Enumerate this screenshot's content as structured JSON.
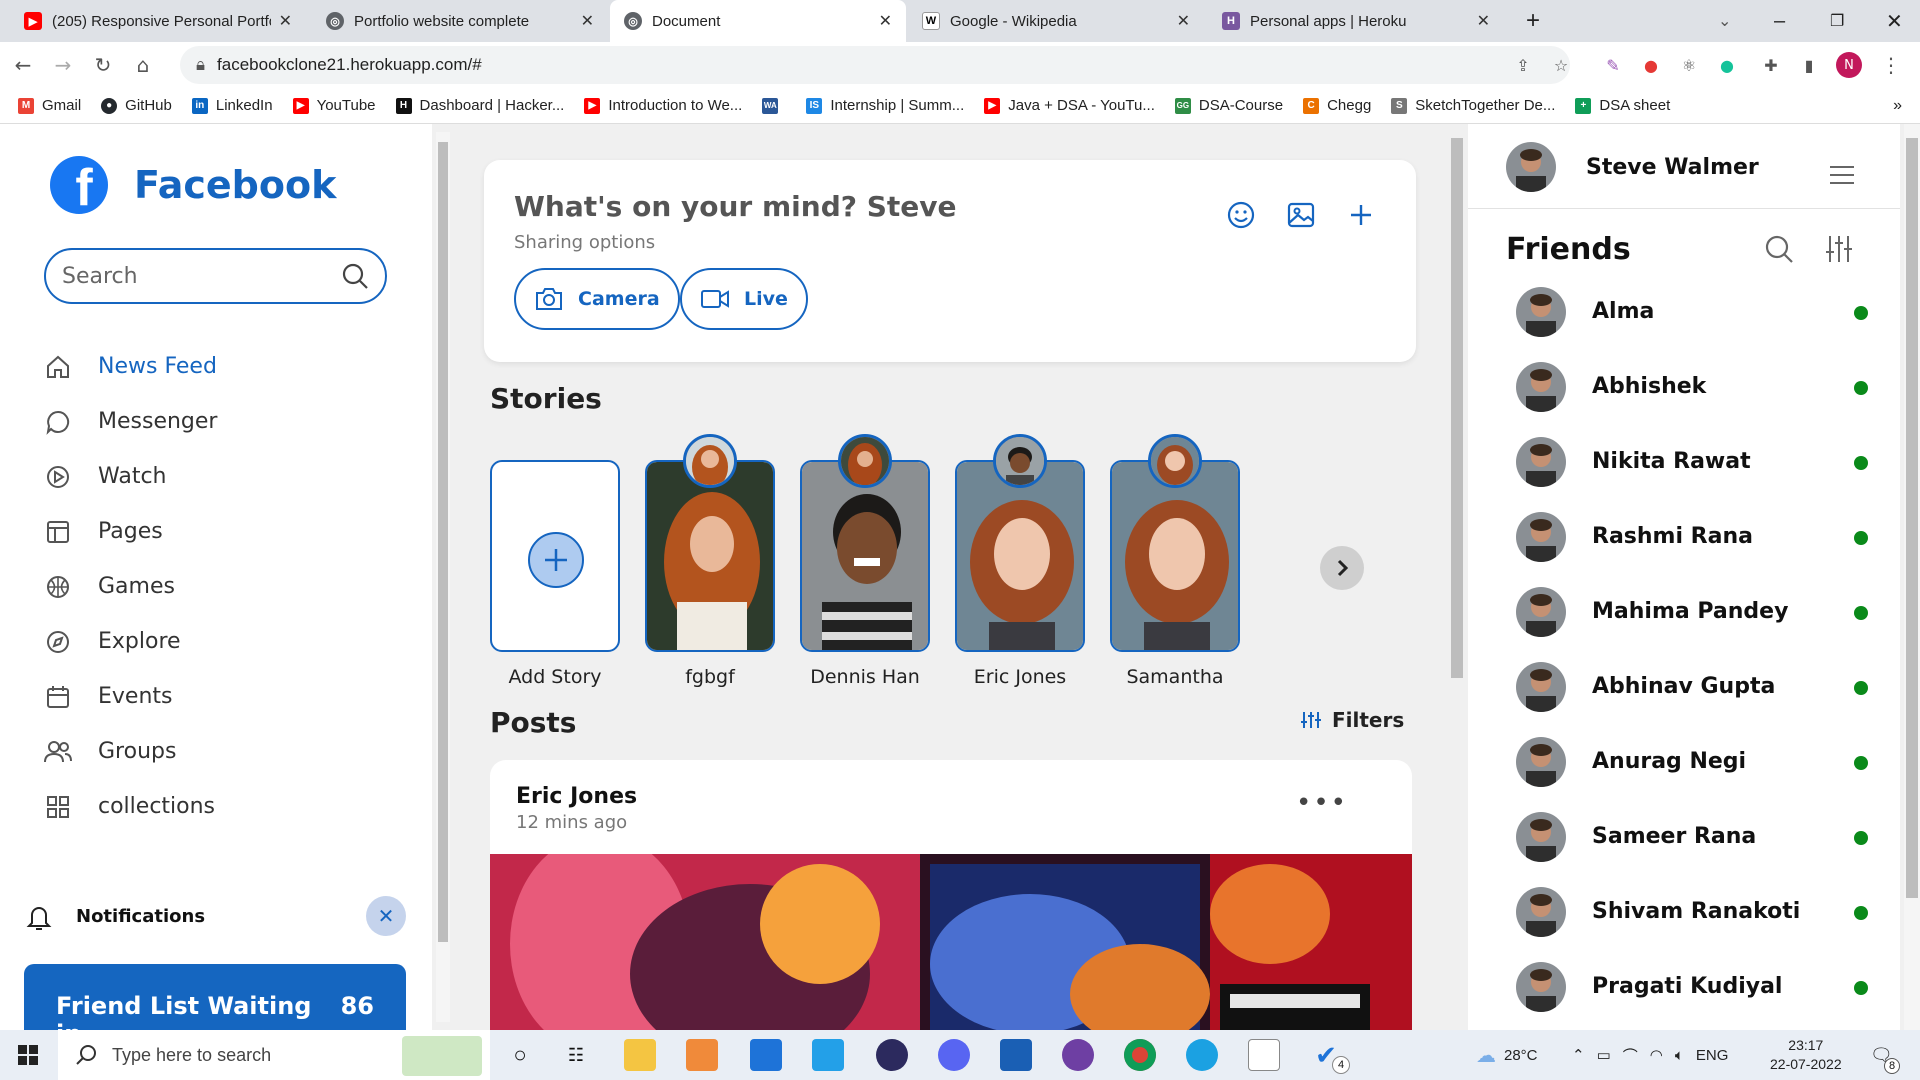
{
  "browser": {
    "tabs": [
      {
        "title": "(205) Responsive Personal Portfo",
        "favicon": "youtube-icon",
        "color": "#ff0000"
      },
      {
        "title": "Portfolio website complete",
        "favicon": "globe-icon",
        "color": "#5f6368"
      },
      {
        "title": "Document",
        "favicon": "globe-icon",
        "color": "#5f6368",
        "active": true
      },
      {
        "title": "Google - Wikipedia",
        "favicon": "wikipedia-icon",
        "color": "#000000"
      },
      {
        "title": "Personal apps | Heroku",
        "favicon": "heroku-icon",
        "color": "#79589f"
      }
    ],
    "url": "facebookclone21.herokuapp.com/#",
    "profile_initial": "N",
    "bookmarks": [
      {
        "label": "Gmail",
        "icon": "gmail-icon",
        "color": "#ea4335"
      },
      {
        "label": "GitHub",
        "icon": "github-icon",
        "color": "#24292e"
      },
      {
        "label": "LinkedIn",
        "icon": "linkedin-icon",
        "color": "#0a66c2"
      },
      {
        "label": "YouTube",
        "icon": "youtube-icon",
        "color": "#ff0000"
      },
      {
        "label": "Dashboard | Hacker...",
        "icon": "hackerearth-icon",
        "color": "#111111"
      },
      {
        "label": "Introduction to We...",
        "icon": "youtube-icon",
        "color": "#ff0000"
      },
      {
        "label": "",
        "icon": "wa-icon",
        "color": "#2b5797"
      },
      {
        "label": "Internship | Summ...",
        "icon": "internshala-icon",
        "color": "#1e88e5"
      },
      {
        "label": "Java + DSA - YouTu...",
        "icon": "youtube-icon",
        "color": "#ff0000"
      },
      {
        "label": "DSA-Course",
        "icon": "gfg-icon",
        "color": "#2f8d46"
      },
      {
        "label": "Chegg",
        "icon": "chegg-icon",
        "color": "#eb7100"
      },
      {
        "label": "SketchTogether De...",
        "icon": "sketch-icon",
        "color": "#777777"
      },
      {
        "label": "DSA sheet",
        "icon": "sheet-icon",
        "color": "#0f9d58"
      }
    ]
  },
  "app": {
    "brand": "Facebook",
    "search_placeholder": "Search",
    "menu": [
      {
        "label": "News Feed",
        "icon": "home-icon",
        "active": true
      },
      {
        "label": "Messenger",
        "icon": "chat-icon"
      },
      {
        "label": "Watch",
        "icon": "play-icon"
      },
      {
        "label": "Pages",
        "icon": "pages-icon"
      },
      {
        "label": "Games",
        "icon": "games-icon"
      },
      {
        "label": "Explore",
        "icon": "compass-icon"
      },
      {
        "label": "Events",
        "icon": "calendar-icon"
      },
      {
        "label": "Groups",
        "icon": "groups-icon"
      },
      {
        "label": "collections",
        "icon": "grid-icon"
      }
    ],
    "notifications_label": "Notifications",
    "friend_card": {
      "text": "Friend List Waiting in",
      "count": "86"
    },
    "composer": {
      "prompt": "What's on your mind? Steve",
      "sub": "Sharing options",
      "camera_label": "Camera",
      "live_label": "Live"
    },
    "stories_heading": "Stories",
    "stories": [
      {
        "label": "Add Story"
      },
      {
        "label": "fgbgf"
      },
      {
        "label": "Dennis Han"
      },
      {
        "label": "Eric Jones"
      },
      {
        "label": "Samantha"
      }
    ],
    "posts_heading": "Posts",
    "filters_label": "Filters",
    "post": {
      "author": "Eric Jones",
      "time": "12 mins ago"
    },
    "profile_name": "Steve Walmer",
    "friends_heading": "Friends",
    "friends": [
      "Alma",
      "Abhishek",
      "Nikita Rawat",
      "Rashmi Rana",
      "Mahima Pandey",
      "Abhinav Gupta",
      "Anurag Negi",
      "Sameer Rana",
      "Shivam Ranakoti",
      "Pragati Kudiyal"
    ],
    "online_color": "#0a8a1a",
    "accent": "#1565c0"
  },
  "taskbar": {
    "search_placeholder": "Type here to search",
    "weather": "28°C",
    "lang": "ENG",
    "time": "23:17",
    "date": "22-07-2022",
    "notif_count": "8",
    "todo_badge": "4"
  }
}
